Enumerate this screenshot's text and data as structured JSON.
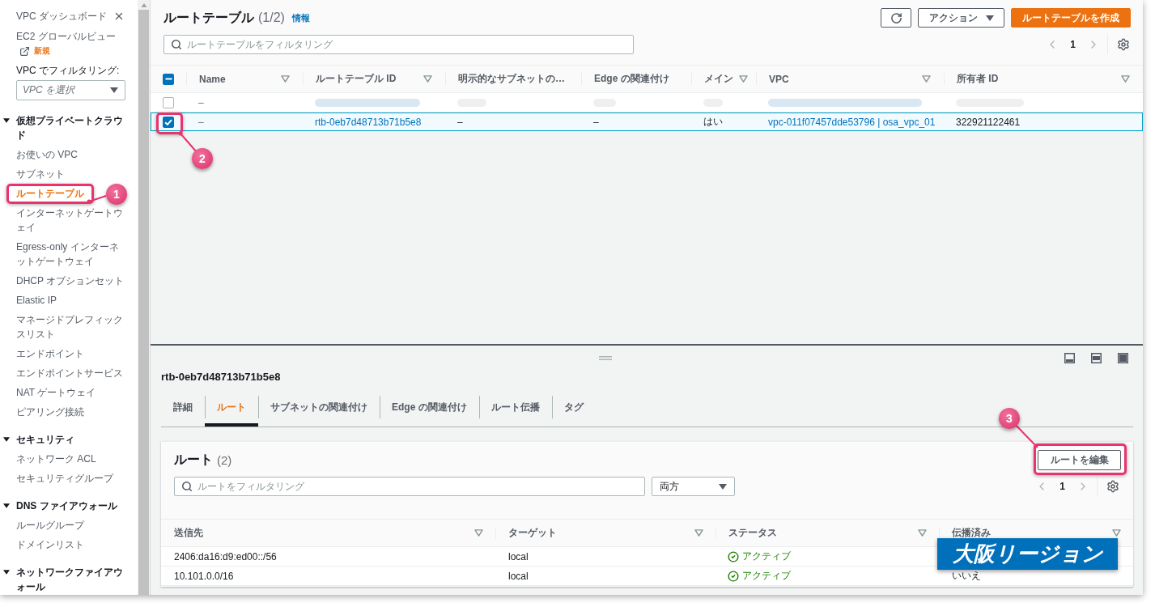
{
  "sidebar": {
    "title": "VPC ダッシュボード",
    "global_view": {
      "label": "EC2 グローバルビュー",
      "badge": "新規"
    },
    "vpc_filter": {
      "label": "VPC でフィルタリング:",
      "placeholder": "VPC を選択"
    },
    "sections": [
      {
        "title": "仮想プライベートクラウド",
        "expanded": true,
        "items": [
          {
            "label": "お使いの VPC",
            "selected": false
          },
          {
            "label": "サブネット",
            "selected": false
          },
          {
            "label": "ルートテーブル",
            "selected": true,
            "callout": "1"
          },
          {
            "label": "インターネットゲートウェイ",
            "selected": false
          },
          {
            "label": "Egress-only インターネットゲートウェイ",
            "selected": false
          },
          {
            "label": "DHCP オプションセット",
            "selected": false
          },
          {
            "label": "Elastic IP",
            "selected": false
          },
          {
            "label": "マネージドプレフィックスリスト",
            "selected": false
          },
          {
            "label": "エンドポイント",
            "selected": false
          },
          {
            "label": "エンドポイントサービス",
            "selected": false
          },
          {
            "label": "NAT ゲートウェイ",
            "selected": false
          },
          {
            "label": "ピアリング接続",
            "selected": false
          }
        ]
      },
      {
        "title": "セキュリティ",
        "expanded": true,
        "items": [
          {
            "label": "ネットワーク ACL",
            "selected": false
          },
          {
            "label": "セキュリティグループ",
            "selected": false
          }
        ]
      },
      {
        "title": "DNS ファイアウォール",
        "expanded": true,
        "items": [
          {
            "label": "ルールグループ",
            "selected": false
          },
          {
            "label": "ドメインリスト",
            "selected": false
          }
        ]
      },
      {
        "title": "ネットワークファイアウォール",
        "expanded": true
      }
    ]
  },
  "route_tables": {
    "title": "ルートテーブル",
    "count": "(1/2)",
    "info": "情報",
    "actions_button": "アクション",
    "create_button": "ルートテーブルを作成",
    "filter_placeholder": "ルートテーブルをフィルタリング",
    "page": "1",
    "select_all": {
      "indeterminate": true
    },
    "columns": [
      {
        "label": "Name",
        "sortable": true
      },
      {
        "label": "ルートテーブル ID",
        "sortable": true
      },
      {
        "label": "明示的なサブネットの…",
        "sortable": false
      },
      {
        "label": "Edge の関連付け",
        "sortable": false
      },
      {
        "label": "メイン",
        "sortable": true
      },
      {
        "label": "VPC",
        "sortable": true
      },
      {
        "label": "所有者 ID",
        "sortable": true
      }
    ],
    "rows": [
      {
        "selected": false,
        "cells": [
          {
            "kind": "muted",
            "text": "–"
          },
          {
            "kind": "blurredlink"
          },
          {
            "kind": "blurred"
          },
          {
            "kind": "blurred"
          },
          {
            "kind": "blurred"
          },
          {
            "kind": "blurredlink"
          },
          {
            "kind": "blurred"
          }
        ]
      },
      {
        "selected": true,
        "callout": "2",
        "cells": [
          {
            "kind": "muted",
            "text": "–"
          },
          {
            "kind": "link",
            "text": "rtb-0eb7d48713b71b5e8"
          },
          {
            "kind": "text",
            "text": "–"
          },
          {
            "kind": "text",
            "text": "–"
          },
          {
            "kind": "text",
            "text": "はい"
          },
          {
            "kind": "link",
            "text": "vpc-011f07457dde53796 | osa_vpc_01"
          },
          {
            "kind": "text",
            "text": "322921122461"
          }
        ]
      }
    ]
  },
  "details": {
    "title": "rtb-0eb7d48713b71b5e8",
    "tabs": [
      {
        "label": "詳細",
        "selected": false
      },
      {
        "label": "ルート",
        "selected": true
      },
      {
        "label": "サブネットの関連付け",
        "selected": false
      },
      {
        "label": "Edge の関連付け",
        "selected": false
      },
      {
        "label": "ルート伝播",
        "selected": false
      },
      {
        "label": "タグ",
        "selected": false
      }
    ],
    "routes": {
      "title": "ルート",
      "count": "(2)",
      "edit_button": {
        "label": "ルートを編集",
        "callout": "3"
      },
      "filter_placeholder": "ルートをフィルタリング",
      "scope_select": "両方",
      "page": "1",
      "columns": [
        {
          "label": "送信先",
          "sortable": true
        },
        {
          "label": "ターゲット",
          "sortable": true
        },
        {
          "label": "ステータス",
          "sortable": true
        },
        {
          "label": "伝播済み",
          "sortable": true
        }
      ],
      "rows": [
        {
          "destination": "2406:da16:d9:ed00::/56",
          "target": "local",
          "status": {
            "kind": "active",
            "label": "アクティブ"
          }
        },
        {
          "destination": "10.101.0.0/16",
          "target": "local",
          "status": {
            "kind": "active",
            "label": "アクティブ"
          },
          "propagated": "いいえ"
        }
      ]
    }
  },
  "region_label": "大阪リージョン"
}
